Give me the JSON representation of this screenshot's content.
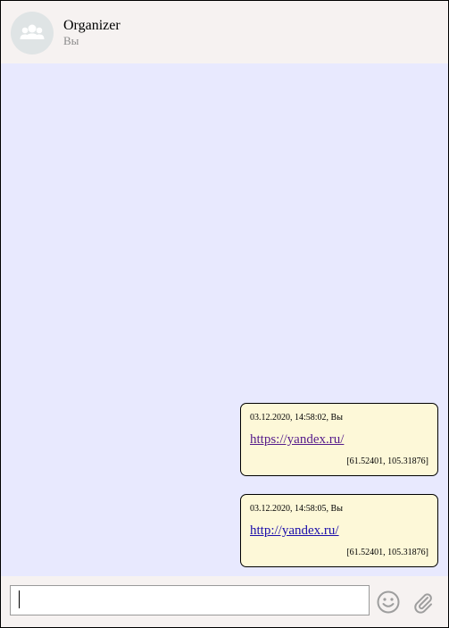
{
  "header": {
    "title": "Organizer",
    "subtitle": "Вы",
    "avatar_icon": "group-icon"
  },
  "messages": [
    {
      "meta": "03.12.2020, 14:58:02, Вы",
      "link": "https://yandex.ru/",
      "coords": "[61.52401, 105.31876]"
    },
    {
      "meta": "03.12.2020, 14:58:05, Вы",
      "link": "http://yandex.ru/",
      "coords": "[61.52401, 105.31876]"
    }
  ],
  "composer": {
    "input_value": "",
    "emoji_icon": "smiley-icon",
    "attach_icon": "paperclip-icon"
  },
  "colors": {
    "chat_background": "#e8e9fe",
    "header_background": "#f6f2f1",
    "bubble_background": "#fdf8d8",
    "visited_link": "#551a8b",
    "link": "#1a0dab"
  }
}
